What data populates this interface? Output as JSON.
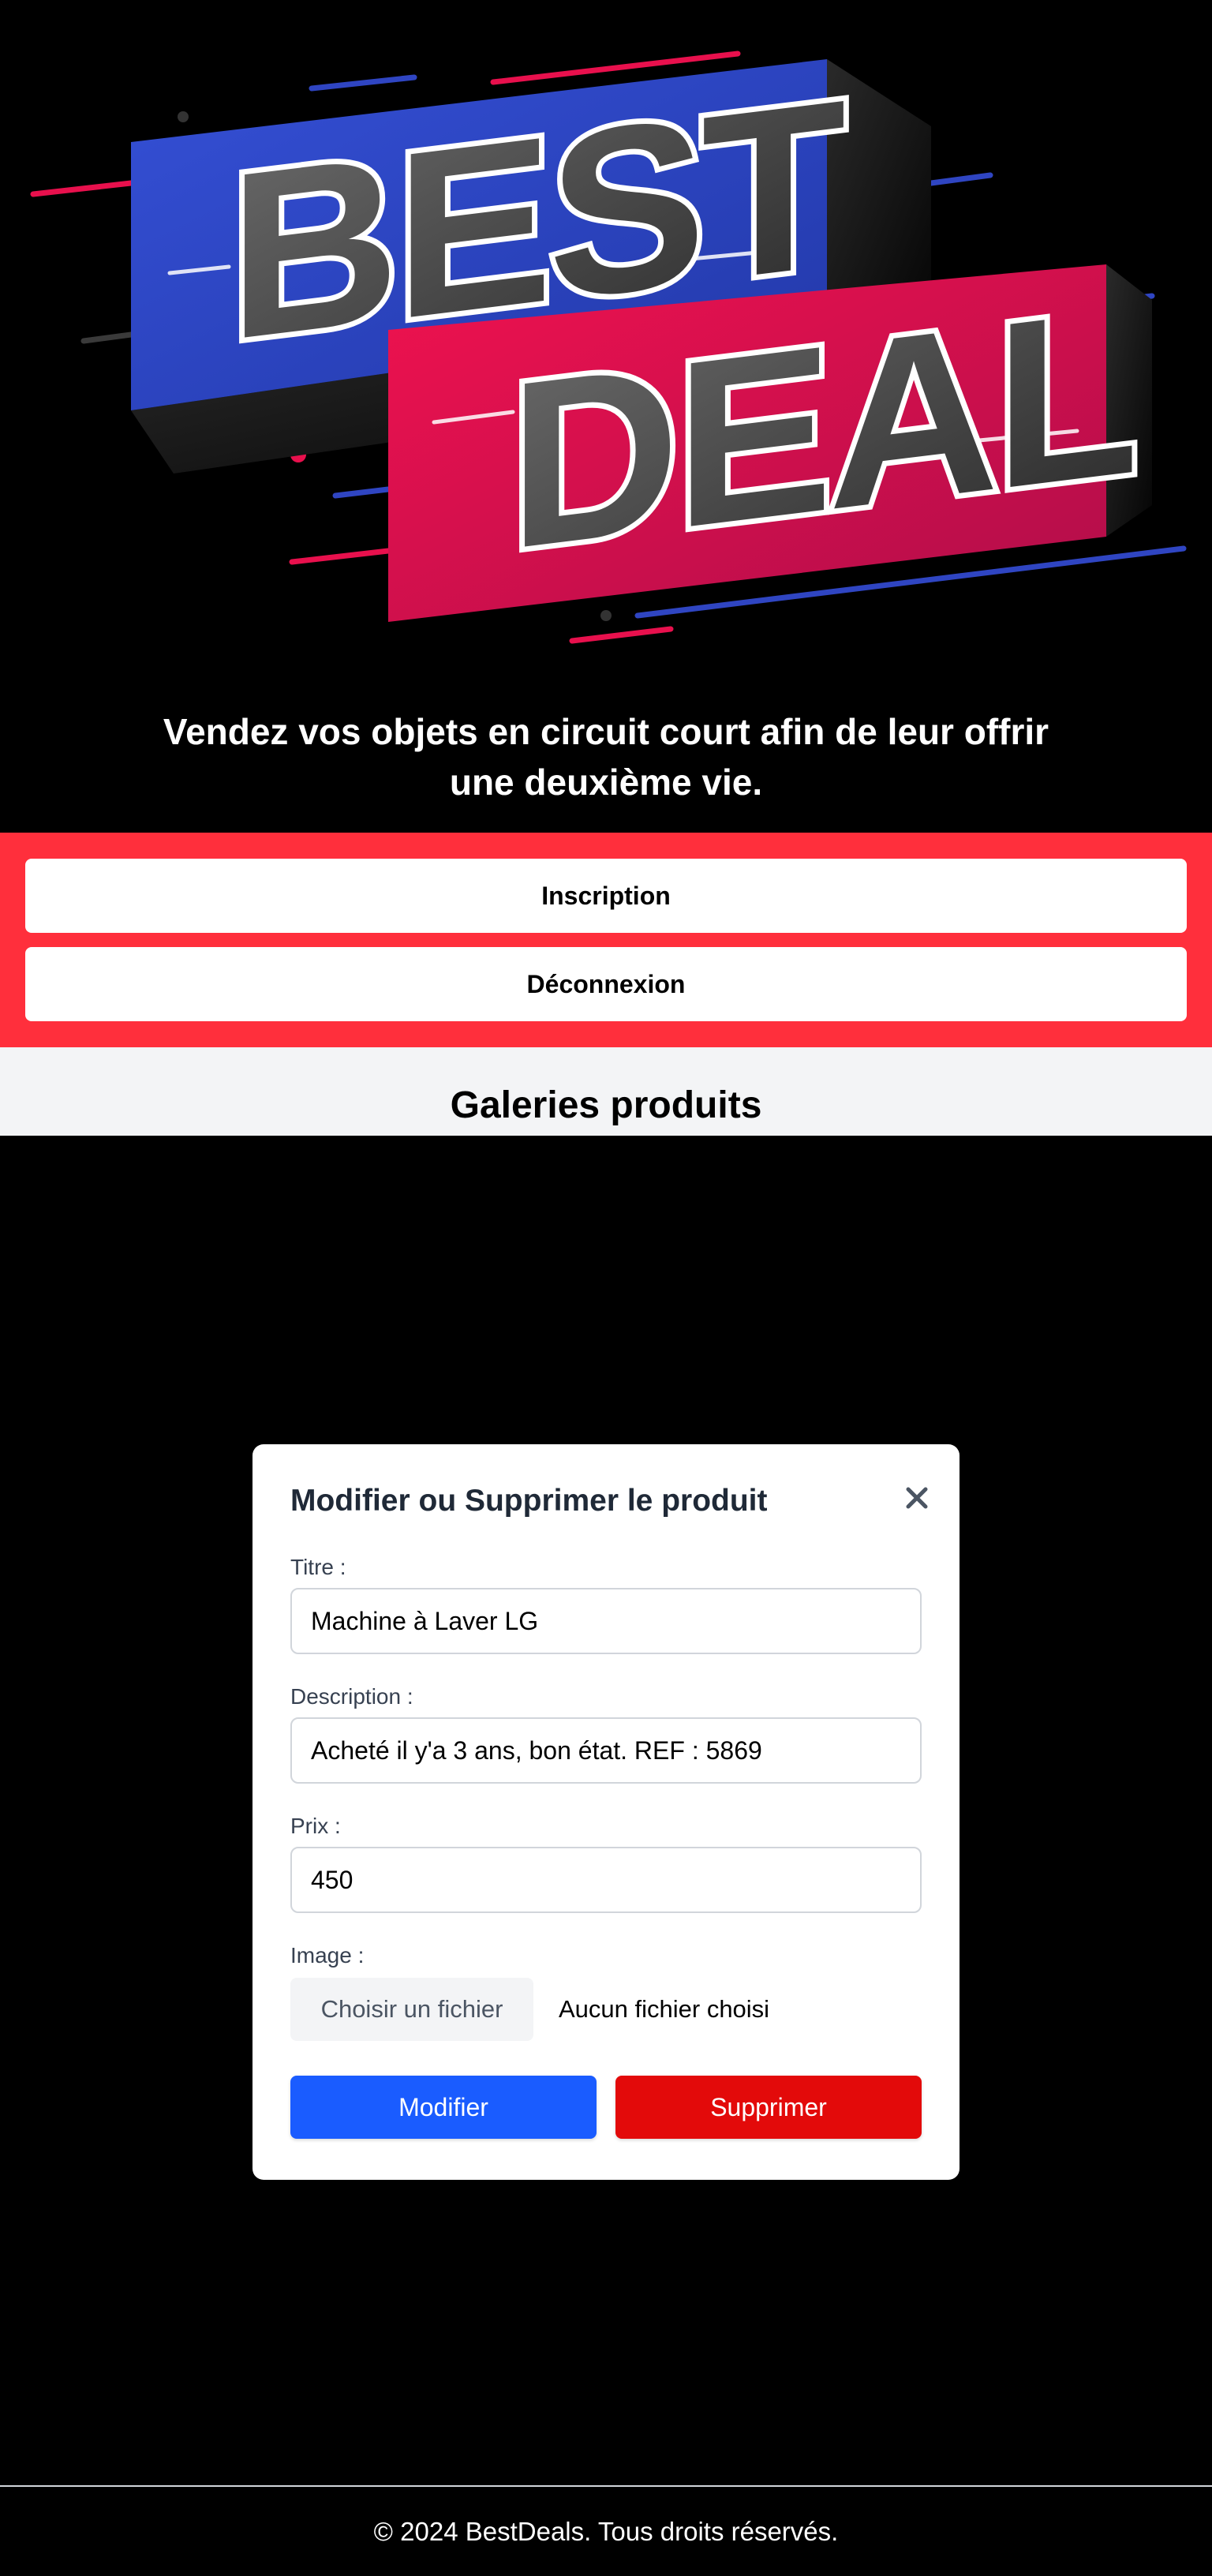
{
  "hero": {
    "logo_line1": "BEST",
    "logo_line2": "DEAL",
    "tagline_line1": "Vendez vos objets en circuit court afin de leur offrir",
    "tagline_line2": "une deuxième vie."
  },
  "auth": {
    "signup_label": "Inscription",
    "logout_label": "Déconnexion"
  },
  "gallery": {
    "title": "Galeries produits"
  },
  "modal": {
    "title": "Modifier ou Supprimer le produit",
    "close_icon": "close-icon",
    "fields": {
      "title_label": "Titre :",
      "title_value": "Machine à Laver LG",
      "description_label": "Description :",
      "description_value": "Acheté il y'a 3 ans, bon état. REF : 5869",
      "price_label": "Prix :",
      "price_value": "450",
      "image_label": "Image :",
      "file_button_label": "Choisir un fichier",
      "file_status": "Aucun fichier choisi"
    },
    "actions": {
      "edit_label": "Modifier",
      "delete_label": "Supprimer"
    }
  },
  "footer": {
    "text": "© 2024 BestDeals. Tous droits réservés."
  },
  "colors": {
    "brand_blue": "#2f45c2",
    "brand_red": "#e8104d",
    "auth_band": "#ff2f3c",
    "edit_button": "#1a5cff",
    "delete_button": "#e30a0a"
  }
}
